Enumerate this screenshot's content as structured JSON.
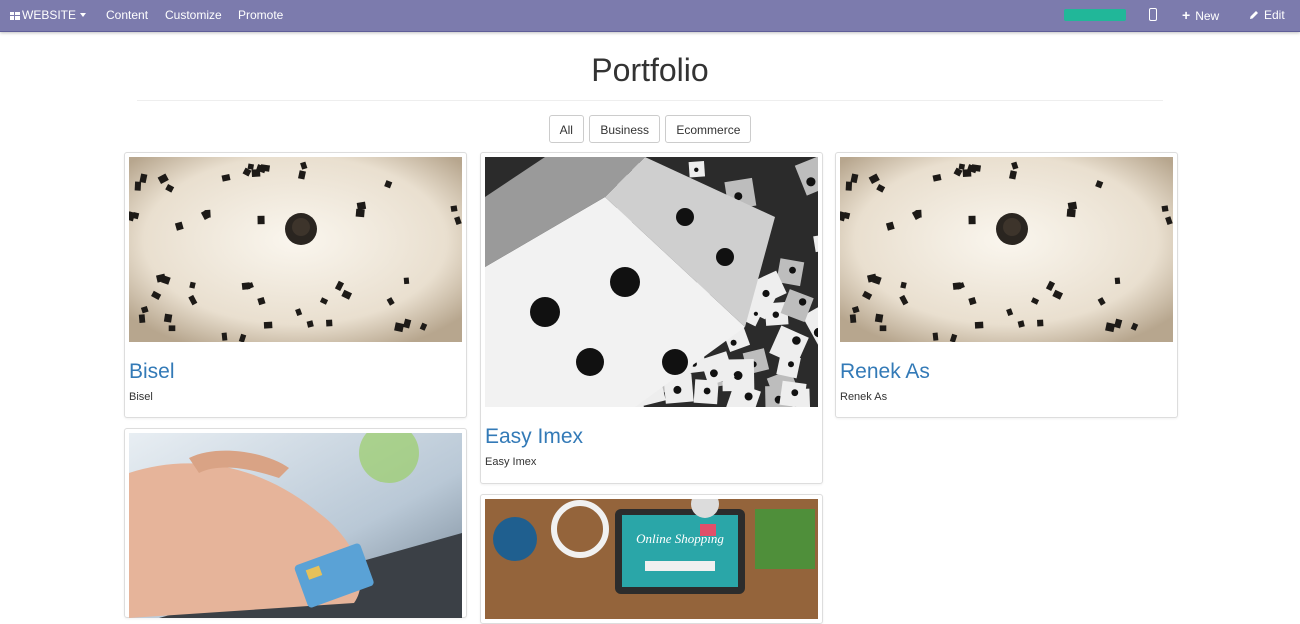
{
  "topbar": {
    "brand": "WEBSITE",
    "menu": [
      "Content",
      "Customize",
      "Promote"
    ],
    "progress_percent": 100,
    "new_label": "New",
    "edit_label": "Edit",
    "bar_color": "#7c7bad",
    "progress_color": "#21b799"
  },
  "page": {
    "title": "Portfolio",
    "filters": [
      "All",
      "Business",
      "Ecommerce"
    ]
  },
  "projects": [
    {
      "title": "Bisel",
      "subtitle": "Bisel",
      "image": "aerial-chairs"
    },
    {
      "title": "Easy Imex",
      "subtitle": "Easy Imex",
      "image": "dice"
    },
    {
      "title": "Renek As",
      "subtitle": "Renek As",
      "image": "aerial-chairs"
    },
    {
      "image": "hand-card-keyboard"
    },
    {
      "image": "online-shopping-laptop"
    }
  ],
  "image_text": {
    "laptop_screen": "Online Shopping"
  }
}
